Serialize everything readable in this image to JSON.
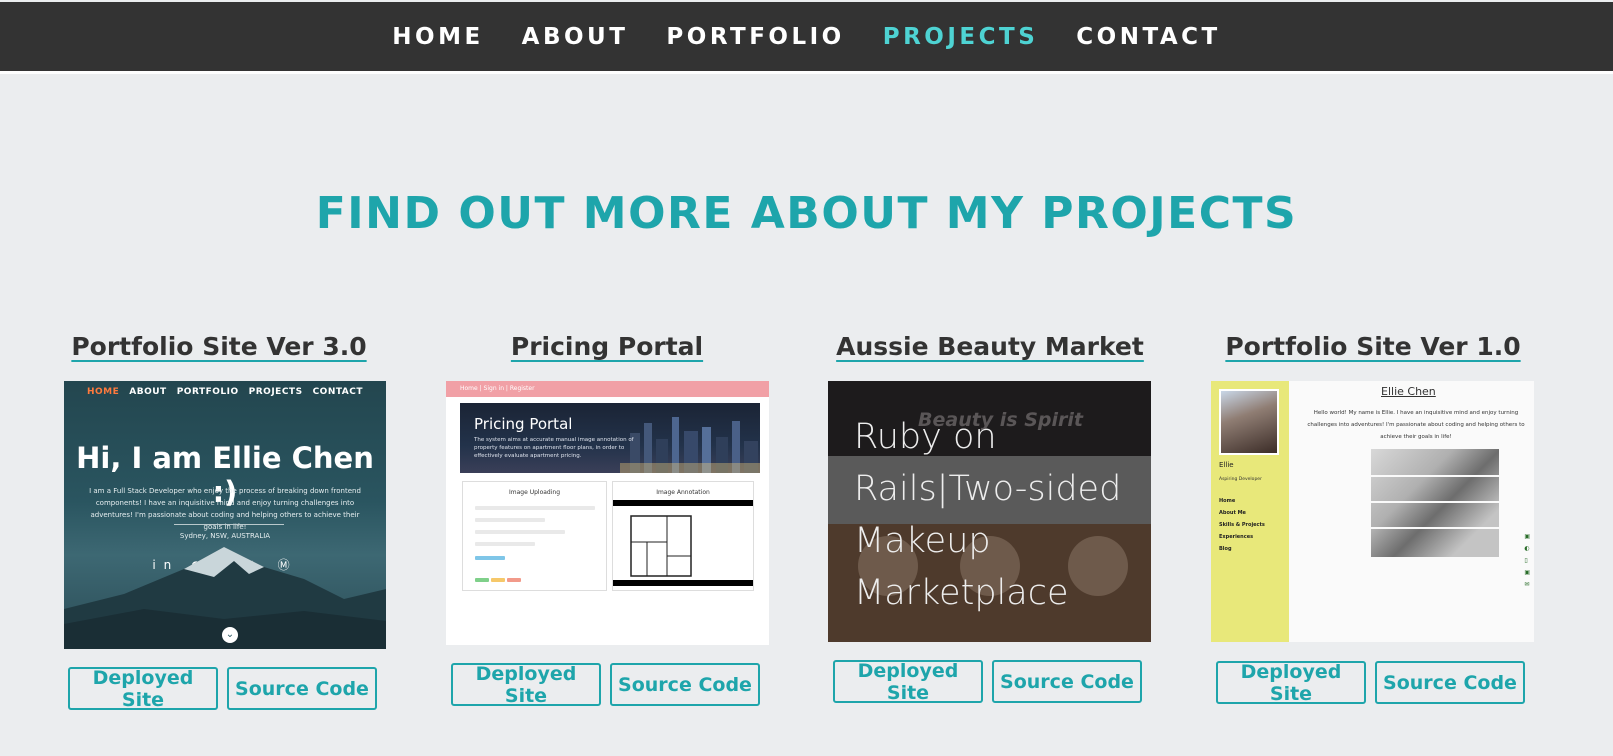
{
  "nav": {
    "items": [
      {
        "label": "HOME",
        "active": false
      },
      {
        "label": "ABOUT",
        "active": false
      },
      {
        "label": "PORTFOLIO",
        "active": false
      },
      {
        "label": "PROJECTS",
        "active": true
      },
      {
        "label": "CONTACT",
        "active": false
      }
    ]
  },
  "heading": "FIND OUT MORE ABOUT MY PROJECTS",
  "projects": [
    {
      "title": "Portfolio Site Ver 3.0",
      "deployed_label": "Deployed Site",
      "source_label": "Source Code",
      "thumb": {
        "nav": [
          "HOME",
          "ABOUT",
          "PORTFOLIO",
          "PROJECTS",
          "CONTACT"
        ],
        "headline": "Hi, I am Ellie Chen :)",
        "description": "I am a Full Stack Developer who enjoy the process of breaking down frontend components! I have an inquisitive mind and enjoy turning challenges into adventures! I'm passionate about coding and helping others to achieve their goals in life!",
        "location": "Sydney, NSW, AUSTRALIA"
      }
    },
    {
      "title": "Pricing Portal",
      "deployed_label": "Deployed Site",
      "source_label": "Source Code",
      "thumb": {
        "topbar": "Home | Sign in | Register",
        "banner_title": "Pricing Portal",
        "banner_text": "The system aims at accurate manual image annotation of property features on apartment floor plans, in order to effectively evaluate apartment pricing.",
        "panel_left": "Image Uploading",
        "panel_right": "Image Annotation"
      }
    },
    {
      "title": "Aussie Beauty Market",
      "deployed_label": "Deployed Site",
      "source_label": "Source Code",
      "thumb": {
        "banner": "Beauty is Spirit",
        "overlay": "Ruby on Rails|Two-sided Makeup Marketplace"
      }
    },
    {
      "title": "Portfolio Site Ver 1.0",
      "deployed_label": "Deployed Site",
      "source_label": "Source Code",
      "thumb": {
        "name": "Ellie Chen",
        "intro": "Hello world! My name is Ellie. I have an inquisitive mind and enjoy turning challenges into adventures! I'm passionate about coding and helping others to achieve their goals in life!",
        "side_name": "Ellie",
        "side_role": "Aspiring Developer",
        "side_menu": [
          "Home",
          "About Me",
          "Skills & Projects",
          "Experiences",
          "Blog"
        ]
      }
    }
  ],
  "colors": {
    "nav_bg": "#333333",
    "accent": "#1ea5ab",
    "nav_active": "#4ed3d3",
    "page_bg": "#ebedef"
  }
}
